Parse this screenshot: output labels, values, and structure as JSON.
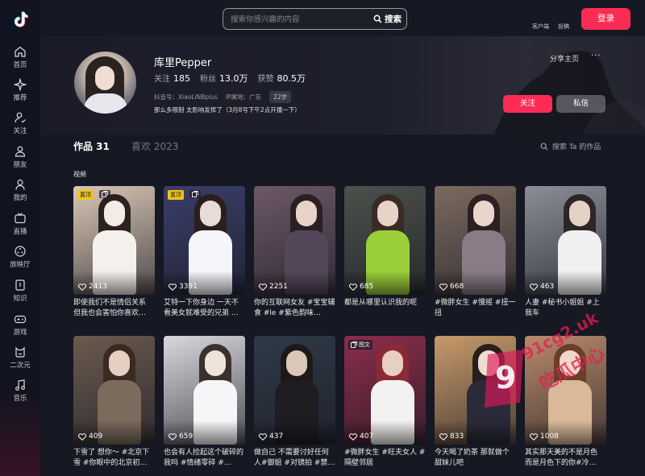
{
  "brand": {
    "accent": "#fe2c55",
    "background": "#161823"
  },
  "sidebar": {
    "items": [
      {
        "label": "首页",
        "icon": "home-icon"
      },
      {
        "label": "推荐",
        "icon": "sparkle-icon"
      },
      {
        "label": "关注",
        "icon": "follow-icon"
      },
      {
        "label": "朋友",
        "icon": "friends-icon"
      },
      {
        "label": "我的",
        "icon": "user-icon"
      },
      {
        "label": "直播",
        "icon": "tv-icon"
      },
      {
        "label": "放映厅",
        "icon": "film-icon"
      },
      {
        "label": "知识",
        "icon": "book-icon"
      },
      {
        "label": "游戏",
        "icon": "gamepad-icon"
      },
      {
        "label": "二次元",
        "icon": "anime-icon"
      },
      {
        "label": "音乐",
        "icon": "music-icon"
      }
    ]
  },
  "header": {
    "search_placeholder": "搜索你感兴趣的内容",
    "search_button": "搜索",
    "client_link": "客户端",
    "submit_link": "投稿",
    "login_button": "登录"
  },
  "profile": {
    "name": "库里Pepper",
    "following_label": "关注",
    "following_value": "185",
    "fans_label": "粉丝",
    "fans_value": "13.0万",
    "likes_label": "获赞",
    "likes_value": "80.5万",
    "douyin_id": "抖音号：XiaoLiNBplus",
    "ip_location": "IP属地：广东",
    "age": "22岁",
    "signature": "那么多限制 太影响发挥了（3月8号下午2点开播一下）",
    "share_home": "分享主页",
    "more": "···",
    "follow_button": "关注",
    "message_button": "私信"
  },
  "tabs": {
    "works_label": "作品 31",
    "likes_label": "喜欢 2023",
    "search_label": "搜索 Ta 的作品"
  },
  "section_label": "视频",
  "videos": [
    {
      "likes": "2413",
      "caption": "即使我们不是情侣关系 但我也会害怕你喜欢…",
      "pinned": "置顶",
      "type": ""
    },
    {
      "likes": "3391",
      "caption": "艾特一下你身边 一天不看美女就难受的兄弟 …",
      "pinned": "置顶",
      "type": ""
    },
    {
      "likes": "2251",
      "caption": "你的互联网女友 #宝宝辅食 #le #紫色韵味…",
      "pinned": "",
      "type": ""
    },
    {
      "likes": "685",
      "caption": "都是从哪里认识我的呢",
      "pinned": "",
      "type": ""
    },
    {
      "likes": "668",
      "caption": "#微胖女生 #慢摇 #扭一扭",
      "pinned": "",
      "type": ""
    },
    {
      "likes": "463",
      "caption": "人妻 #秘书小姐姐 #上我车",
      "pinned": "",
      "type": ""
    },
    {
      "likes": "409",
      "caption": "下雪了 想你～ #北京下雪 #你眼中的北京初…",
      "pinned": "",
      "type": ""
    },
    {
      "likes": "659",
      "caption": "也会有人捡起这个破碎的我吗 #情绪零碎 #…",
      "pinned": "",
      "type": ""
    },
    {
      "likes": "437",
      "caption": "做自己 不需要讨好任何人#御姐 #对镜拍 #禁…",
      "pinned": "",
      "type": ""
    },
    {
      "likes": "407",
      "caption": "#微胖女生 #旺夫女人 #隔壁邻居",
      "pinned": "",
      "type": "图文"
    },
    {
      "likes": "833",
      "caption": "今天喝了奶茶 那就做个甜妹儿吧",
      "pinned": "",
      "type": ""
    },
    {
      "likes": "1008",
      "caption": "其实那天美的不是月色 而是月色下的你#冷…",
      "pinned": "",
      "type": ""
    }
  ],
  "watermark": {
    "line1": "91cg2.uk",
    "line2": "吃瓜中心",
    "logo": "9"
  }
}
